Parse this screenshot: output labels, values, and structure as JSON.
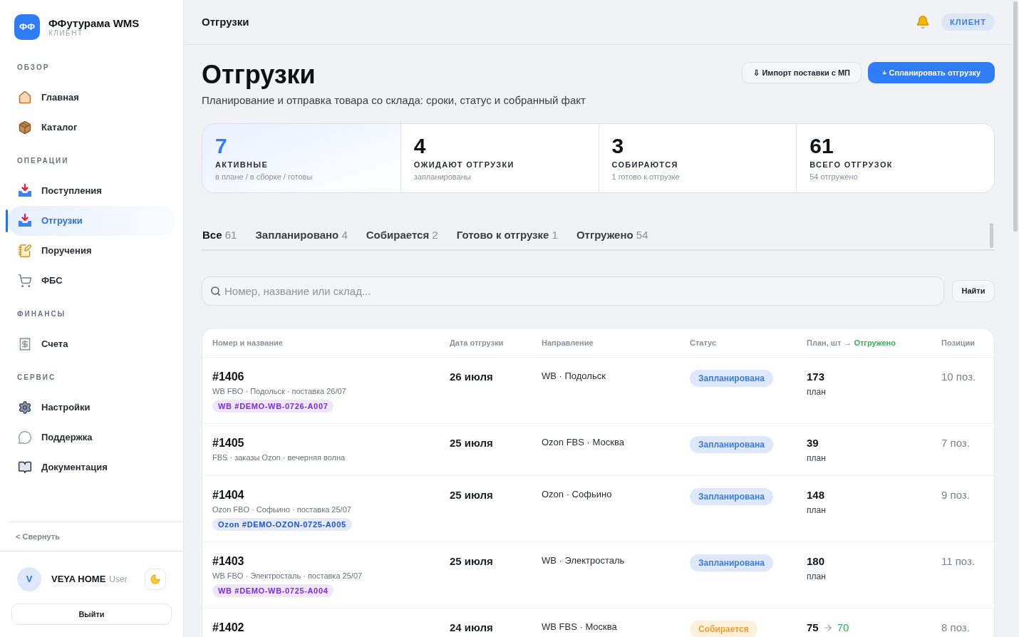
{
  "brand": {
    "logo": "ФФ",
    "name": "ФФутурама WMS",
    "subtitle": "КЛИЕНТ"
  },
  "sidebar": {
    "sections": [
      {
        "label": "ОБЗОР",
        "items": [
          {
            "label": "Главная",
            "selected": false
          },
          {
            "label": "Каталог",
            "selected": false
          }
        ]
      },
      {
        "label": "ОПЕРАЦИИ",
        "items": [
          {
            "label": "Поступления",
            "selected": false
          },
          {
            "label": "Отгрузки",
            "selected": true
          },
          {
            "label": "Поручения",
            "selected": false
          },
          {
            "label": "ФБС",
            "selected": false
          }
        ]
      },
      {
        "label": "ФИНАНСЫ",
        "items": [
          {
            "label": "Счета",
            "selected": false
          }
        ]
      },
      {
        "label": "СЕРВИС",
        "items": [
          {
            "label": "Настройки",
            "selected": false
          },
          {
            "label": "Поддержка",
            "selected": false
          },
          {
            "label": "Документация",
            "selected": false
          }
        ]
      }
    ],
    "collapse": "< Свернуть",
    "user": {
      "initial": "V",
      "name": "VEYA HOME",
      "role": "User"
    },
    "logout": "Выйти"
  },
  "header": {
    "title": "Отгрузки",
    "badge": "КЛИЕНТ"
  },
  "page": {
    "title": "Отгрузки",
    "subtitle": "Планирование и отправка товара со склада: сроки, статус и собранный факт",
    "buttons": [
      {
        "label": "⇩ Импорт поставки с МП",
        "kind": "secondary"
      },
      {
        "label": "+ Спланировать отгрузку",
        "kind": "primary"
      }
    ]
  },
  "stats": [
    {
      "value": "7",
      "label": "АКТИВНЫЕ",
      "note": "в плане / в сборке / готовы",
      "highlighted": true
    },
    {
      "value": "4",
      "label": "ОЖИДАЮТ ОТГРУЗКИ",
      "note": "запланированы",
      "highlighted": false
    },
    {
      "value": "3",
      "label": "СОБИРАЮТСЯ",
      "note": "1 готово к отгрузке",
      "highlighted": false
    },
    {
      "value": "61",
      "label": "ВСЕГО ОТГРУЗОК",
      "note": "54 отгружено",
      "highlighted": false
    }
  ],
  "tabs": [
    {
      "label": "Все",
      "count": "61",
      "selected": true
    },
    {
      "label": "Запланировано",
      "count": "4",
      "selected": false
    },
    {
      "label": "Собирается",
      "count": "2",
      "selected": false
    },
    {
      "label": "Готово к отгрузке",
      "count": "1",
      "selected": false
    },
    {
      "label": "Отгружено",
      "count": "54",
      "selected": false
    }
  ],
  "search": {
    "placeholder": "Номер, название или склад...",
    "button": "Найти"
  },
  "table": {
    "columns": [
      {
        "label": "Номер и название"
      },
      {
        "label": "Дата отгрузки"
      },
      {
        "label": "Направление"
      },
      {
        "label": "Статус"
      },
      {
        "label": "План, шт",
        "legend": "→ Отгружено"
      },
      {
        "label": "Позиции"
      }
    ],
    "rows": [
      {
        "number": "#1406",
        "description": "WB FBO · Подольск · поставка 26/07",
        "tag": {
          "label": "WB #DEMO-WB-0726-A007",
          "color": "#7b2ee0"
        },
        "date": "26 июля",
        "direction": "WB · Подольск",
        "status": {
          "label": "Запланирована",
          "kind": "planned"
        },
        "plan": "173",
        "plan_note": "план",
        "positions": "10 поз."
      },
      {
        "number": "#1405",
        "description": "FBS · заказы Ozon · вечерняя волна",
        "date": "25 июля",
        "direction": "Ozon FBS · Москва",
        "status": {
          "label": "Запланирована",
          "kind": "planned"
        },
        "plan": "39",
        "plan_note": "план",
        "positions": "7 поз."
      },
      {
        "number": "#1404",
        "description": "Ozon FBO · Софьино · поставка 25/07",
        "tag": {
          "label": "Ozon #DEMO-OZON-0725-A005",
          "color": "#1f4fd6"
        },
        "date": "25 июля",
        "direction": "Ozon · Софьино",
        "status": {
          "label": "Запланирована",
          "kind": "planned"
        },
        "plan": "148",
        "plan_note": "план",
        "positions": "9 поз."
      },
      {
        "number": "#1403",
        "description": "WB FBO · Электросталь · поставка 25/07",
        "tag": {
          "label": "WB #DEMO-WB-0725-A004",
          "color": "#7b2ee0"
        },
        "date": "25 июля",
        "direction": "WB · Электросталь",
        "status": {
          "label": "Запланирована",
          "kind": "planned"
        },
        "plan": "180",
        "plan_note": "план",
        "positions": "11 поз."
      },
      {
        "number": "#1402",
        "date": "24 июля",
        "direction": "WB FBS · Москва",
        "status": {
          "label": "Собирается",
          "kind": "assembling"
        },
        "plan": "75",
        "shipped": "70",
        "positions": "8 поз."
      }
    ]
  }
}
